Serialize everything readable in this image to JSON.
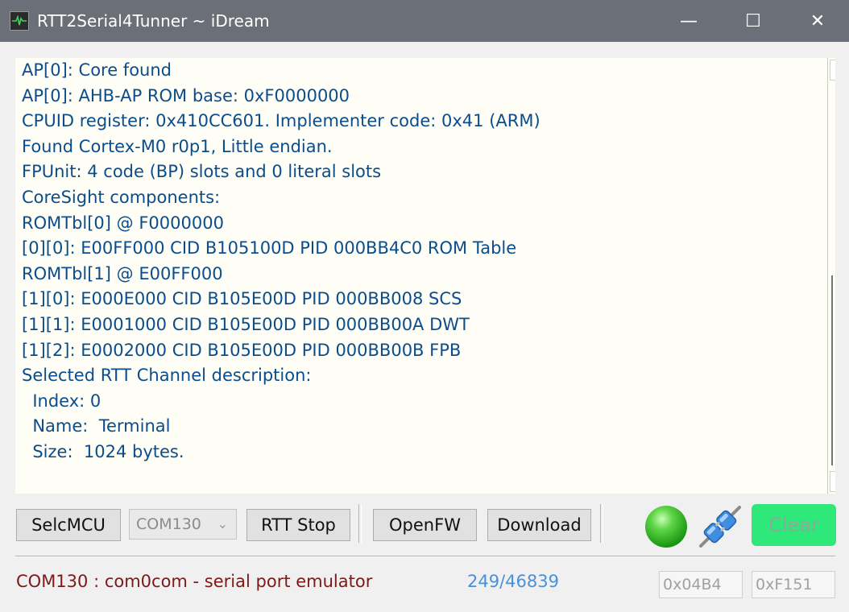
{
  "window": {
    "title": "RTT2Serial4Tunner ~ iDream",
    "min_glyph": "—",
    "max_glyph": "☐",
    "close_glyph": "✕"
  },
  "log": {
    "lines": [
      "AP[0]: Core found",
      "AP[0]: AHB-AP ROM base: 0xF0000000",
      "CPUID register: 0x410CC601. Implementer code: 0x41 (ARM)",
      "Found Cortex-M0 r0p1, Little endian.",
      "FPUnit: 4 code (BP) slots and 0 literal slots",
      "CoreSight components:",
      "ROMTbl[0] @ F0000000",
      "[0][0]: E00FF000 CID B105100D PID 000BB4C0 ROM Table",
      "ROMTbl[1] @ E00FF000",
      "[1][0]: E000E000 CID B105E00D PID 000BB008 SCS",
      "[1][1]: E0001000 CID B105E00D PID 000BB00A DWT",
      "[1][2]: E0002000 CID B105E00D PID 000BB00B FPB",
      "Selected RTT Channel description:",
      "  Index: 0",
      "  Name:  Terminal",
      "  Size:  1024 bytes."
    ],
    "text_color": "#0b4d8c",
    "scroll_up_glyph": "▲",
    "scroll_down_glyph": "▼"
  },
  "toolbar": {
    "selmcu_label": "SelcMCU",
    "com_select_value": "COM130",
    "com_select_arrow": "⌄",
    "rtt_stop_label": "RTT Stop",
    "openfw_label": "OpenFW",
    "download_label": "Download",
    "clear_label": "Clear",
    "led_icon": "green-led-icon",
    "connect_icon": "plug-connect-icon",
    "led_color": "#2fb51f",
    "clear_color": "#2ee87a"
  },
  "statusbar": {
    "port_status": "COM130 : com0com - serial port emulator",
    "counter": "249/46839",
    "hex_left": "0x04B4",
    "hex_right": "0xF151"
  }
}
